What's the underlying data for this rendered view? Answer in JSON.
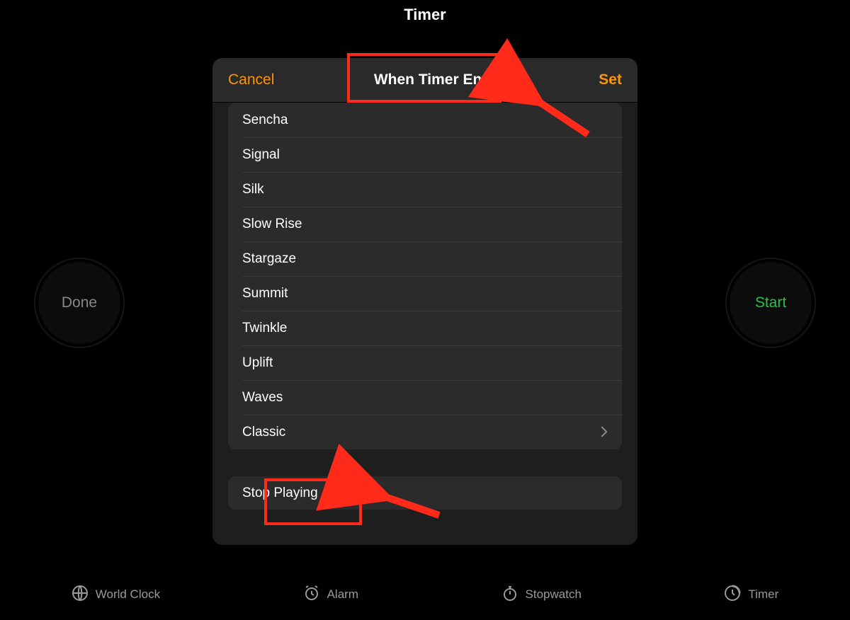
{
  "page": {
    "title": "Timer"
  },
  "background_buttons": {
    "done": "Done",
    "start": "Start"
  },
  "modal": {
    "cancel": "Cancel",
    "title": "When Timer Ends",
    "set": "Set",
    "sounds": [
      "Sencha",
      "Signal",
      "Silk",
      "Slow Rise",
      "Stargaze",
      "Summit",
      "Twinkle",
      "Uplift",
      "Waves"
    ],
    "classic": "Classic",
    "stop_playing": "Stop Playing"
  },
  "tabs": {
    "world_clock": "World Clock",
    "alarm": "Alarm",
    "stopwatch": "Stopwatch",
    "timer": "Timer"
  }
}
